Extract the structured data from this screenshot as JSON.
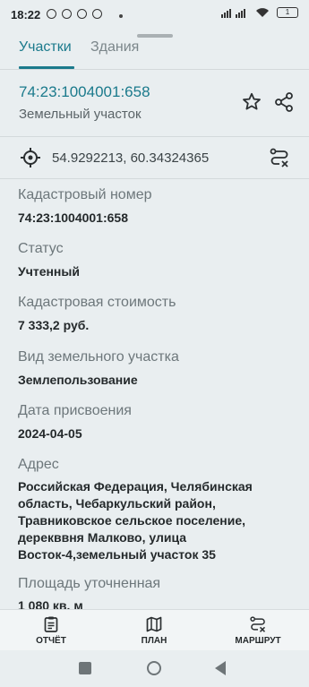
{
  "status_bar": {
    "time": "18:22",
    "battery": "1"
  },
  "tabs": [
    {
      "label": "Участки"
    },
    {
      "label": "Здания"
    }
  ],
  "parcel": {
    "id": "74:23:1004001:658",
    "type": "Земельный участок",
    "coordinates": "54.9292213, 60.34324365"
  },
  "fields": [
    {
      "label": "Кадастровый номер",
      "value": "74:23:1004001:658"
    },
    {
      "label": "Статус",
      "value": "Учтенный"
    },
    {
      "label": "Кадастровая стоимость",
      "value": "7 333,2 руб."
    },
    {
      "label": "Вид земельного участка",
      "value": "Землепользование"
    },
    {
      "label": "Дата присвоения",
      "value": "2024-04-05"
    },
    {
      "label": "Адрес",
      "value_lines": [
        "Российская Федерация, Челябинская",
        "область, Чебаркульский район,",
        "Травниковское сельское поселение,",
        "дерекввня Малково, улица",
        "Восток-4,земельный участок  35"
      ]
    },
    {
      "label": "Площадь уточненная",
      "value": "1 080 кв. м"
    }
  ],
  "bottom_nav": {
    "report": "ОТЧЁТ",
    "plan": "ПЛАН",
    "route": "МАРШРУТ"
  },
  "colors": {
    "accent": "#1b7a8c",
    "background": "#e9eef0"
  }
}
